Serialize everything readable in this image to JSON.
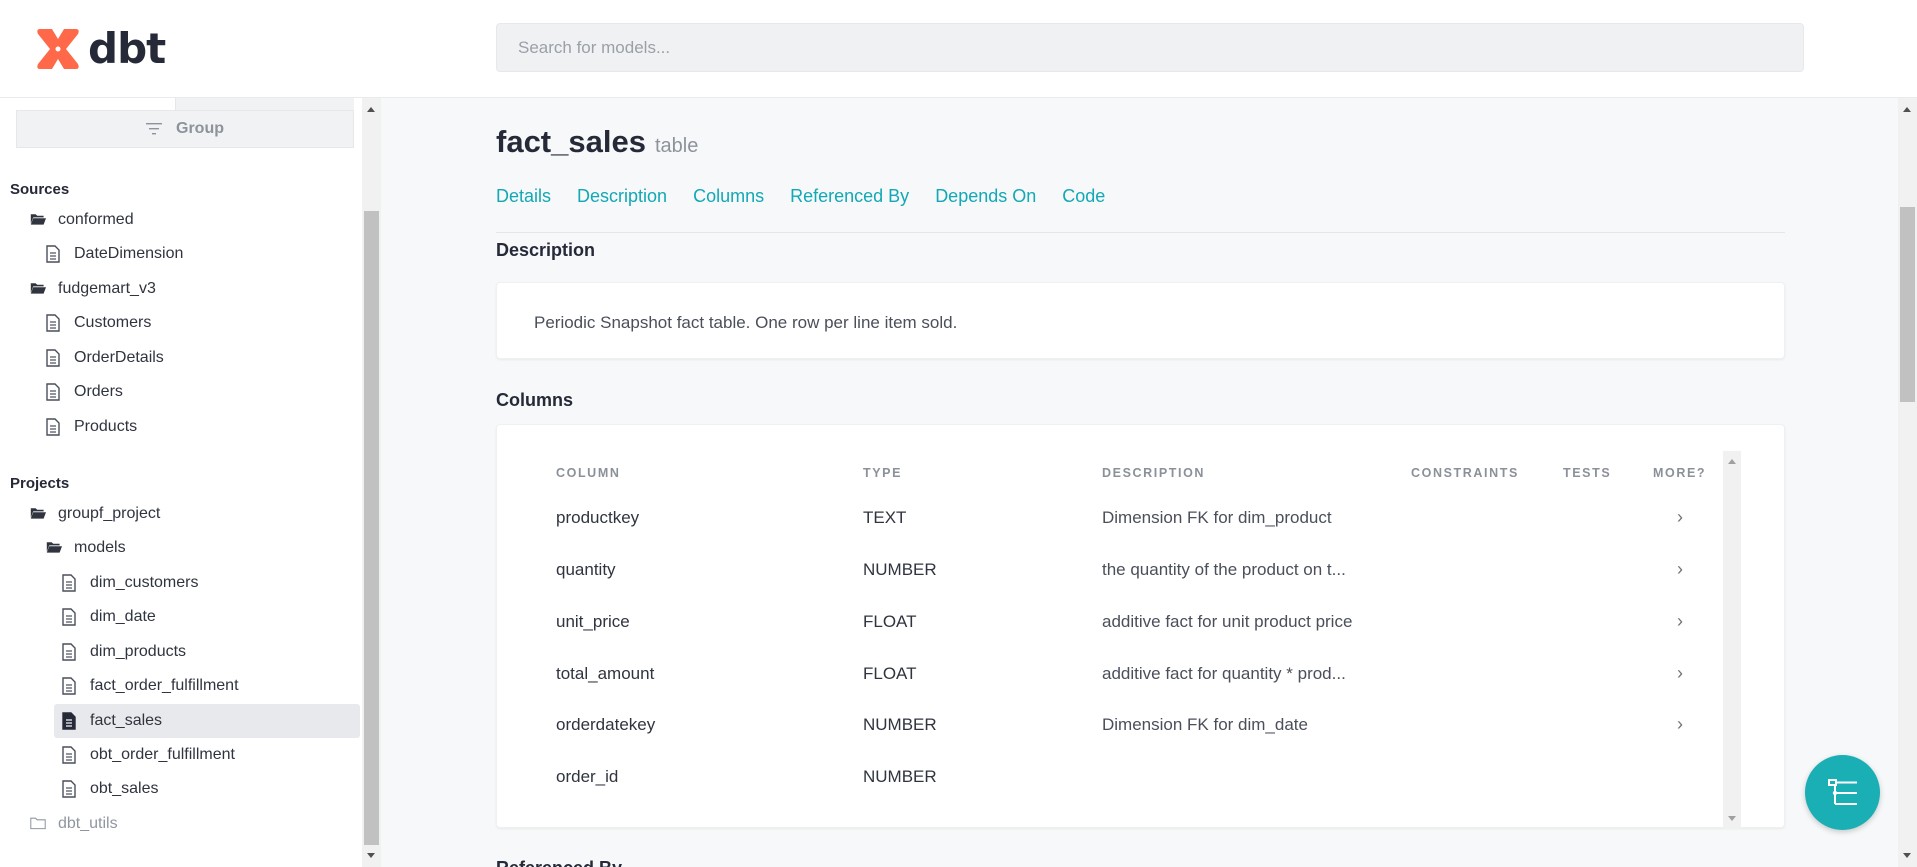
{
  "header": {
    "logo_text": "dbt",
    "search_placeholder": "Search for models..."
  },
  "sidebar": {
    "group_label": "Group",
    "sources_heading": "Sources",
    "projects_heading": "Projects",
    "tree": [
      {
        "label": "conformed",
        "icon": "folder-open-icon"
      },
      {
        "label": "DateDimension",
        "icon": "document-icon"
      },
      {
        "label": "fudgemart_v3",
        "icon": "folder-open-icon"
      },
      {
        "label": "Customers",
        "icon": "document-icon"
      },
      {
        "label": "OrderDetails",
        "icon": "document-icon"
      },
      {
        "label": "Orders",
        "icon": "document-icon"
      },
      {
        "label": "Products",
        "icon": "document-icon"
      },
      {
        "label": "groupf_project",
        "icon": "folder-open-icon"
      },
      {
        "label": "models",
        "icon": "folder-open-icon"
      },
      {
        "label": "dim_customers",
        "icon": "document-icon"
      },
      {
        "label": "dim_date",
        "icon": "document-icon"
      },
      {
        "label": "dim_products",
        "icon": "document-icon"
      },
      {
        "label": "fact_order_fulfillment",
        "icon": "document-icon"
      },
      {
        "label": "fact_sales",
        "icon": "document-filled-icon",
        "active": true
      },
      {
        "label": "obt_order_fulfillment",
        "icon": "document-icon"
      },
      {
        "label": "obt_sales",
        "icon": "document-icon"
      },
      {
        "label": "dbt_utils",
        "icon": "folder-closed-icon"
      }
    ]
  },
  "model": {
    "name": "fact_sales",
    "kind": "table"
  },
  "nav": [
    "Details",
    "Description",
    "Columns",
    "Referenced By",
    "Depends On",
    "Code"
  ],
  "description": {
    "heading": "Description",
    "text": "Periodic Snapshot fact table. One row per line item sold."
  },
  "columns": {
    "heading": "Columns",
    "headers": [
      "COLUMN",
      "TYPE",
      "DESCRIPTION",
      "CONSTRAINTS",
      "TESTS",
      "MORE?"
    ],
    "rows": [
      {
        "column": "productkey",
        "type": "TEXT",
        "description": "Dimension FK for dim_product",
        "more": "›"
      },
      {
        "column": "quantity",
        "type": "NUMBER",
        "description": "the quantity of the product on t...",
        "more": "›"
      },
      {
        "column": "unit_price",
        "type": "FLOAT",
        "description": "additive fact for unit product price",
        "more": "›"
      },
      {
        "column": "total_amount",
        "type": "FLOAT",
        "description": "additive fact for quantity * prod...",
        "more": "›"
      },
      {
        "column": "orderdatekey",
        "type": "NUMBER",
        "description": "Dimension FK for dim_date",
        "more": "›"
      },
      {
        "column": "order_id",
        "type": "NUMBER",
        "description": "",
        "more": ""
      }
    ]
  },
  "next_section_heading": "Referenced By",
  "colors": {
    "accent": "#12a8b5",
    "fab": "#1aafb5",
    "logo": "#ff694a"
  }
}
